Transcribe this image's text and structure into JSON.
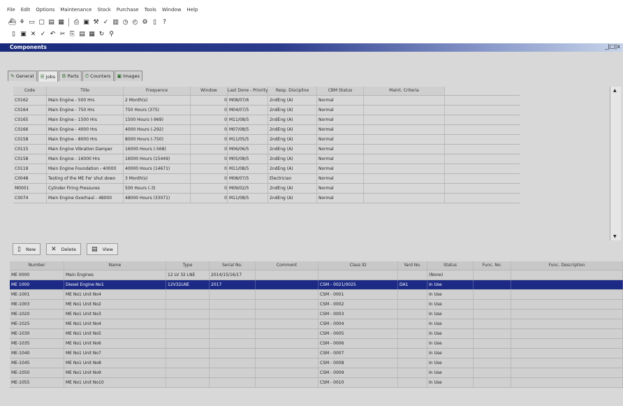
{
  "menu": [
    "File",
    "Edit",
    "Options",
    "Maintenance",
    "Stock",
    "Purchase",
    "Tools",
    "Window",
    "Help"
  ],
  "window": {
    "title": "Components",
    "controls": "_|□|x"
  },
  "tabs": [
    {
      "label": "General",
      "icon": "✎"
    },
    {
      "label": "Jobs",
      "icon": "☰"
    },
    {
      "label": "Parts",
      "icon": "⚙"
    },
    {
      "label": "Counters",
      "icon": "⏱"
    },
    {
      "label": "Images",
      "icon": "▣"
    }
  ],
  "jobs_columns": [
    "Code",
    "Title",
    "Frequence",
    "Window",
    "Last Done - Priority",
    "Resp. Discipline",
    "CBM Status",
    "Maint. Criteria"
  ],
  "jobs_rows": [
    [
      "C0162",
      "Main Engine - 500 Hrs",
      "2 Month(s)",
      "0",
      "M08/07/6",
      "2ndEng (A)",
      "Normal",
      ""
    ],
    [
      "C0164",
      "Main Engine - 750 Hrs",
      "750 Hours (375)",
      "0",
      "M04/07/5",
      "2ndEng (A)",
      "Normal",
      ""
    ],
    [
      "C0165",
      "Main Engine - 1500 Hrs",
      "1500 Hours (-969)",
      "0",
      "M11/08/5",
      "2ndEng (A)",
      "Normal",
      ""
    ],
    [
      "C0166",
      "Main Engine - 4000 Hrs",
      "4000 Hours (-292)",
      "0",
      "M07/08/5",
      "2ndEng (A)",
      "Normal",
      ""
    ],
    [
      "C0158",
      "Main Engine - 8000 Hrs",
      "8000 Hours (-750)",
      "0",
      "M11/05/5",
      "2ndEng (A)",
      "Normal",
      ""
    ],
    [
      "C0115",
      "Main Engine Vibration Damper",
      "16000 Hours (-568)",
      "0",
      "M06/06/5",
      "2ndEng (A)",
      "Normal",
      ""
    ],
    [
      "C0158",
      "Main Engine - 16000 Hrs",
      "16000 Hours (15449)",
      "0",
      "M05/08/5",
      "2ndEng (A)",
      "Normal",
      ""
    ],
    [
      "C0119",
      "Main Engine Foundation - 40000",
      "40000 Hours (14671)",
      "0",
      "M11/08/5",
      "2ndEng (A)",
      "Normal",
      ""
    ],
    [
      "C0048",
      "Testing of the ME Fw' shut down",
      "3 Month(s)",
      "0",
      "M08/07/5",
      "Electrician",
      "Normal",
      ""
    ],
    [
      "M0001",
      "Cylinder Firing Pressures",
      "500 Hours (-3)",
      "0",
      "M09/02/5",
      "2ndEng (A)",
      "Normal",
      ""
    ],
    [
      "C0074",
      "Main Engine Overhaul - 48000",
      "48000 Hours (33071)",
      "0",
      "M11/08/5",
      "2ndEng (A)",
      "Normal",
      ""
    ]
  ],
  "buttons": {
    "new": "New",
    "delete": "Delete",
    "view": "View"
  },
  "comp_columns": [
    "Number",
    "Name",
    "Type",
    "Serial No.",
    "Comment",
    "Class ID",
    "Yard No.",
    "Status",
    "Func. No.",
    "Func. Description"
  ],
  "comp_rows": [
    [
      "ME 0000",
      "Main Engines",
      "12 LV 32 LNE",
      "2014/15/16/17",
      "",
      "",
      "",
      "(None)",
      "",
      ""
    ],
    [
      "ME 1000",
      "Diesel Engine No1",
      "12V32LNE",
      "2017",
      "",
      "CSM - 0021/0025",
      "DA1",
      "In Use",
      "",
      ""
    ],
    [
      "ME-1001",
      "ME No1 Unit No4",
      "",
      "",
      "",
      "CSM - 0001",
      "",
      "In Use",
      "",
      ""
    ],
    [
      "ME-1003",
      "ME No1 Unit No2",
      "",
      "",
      "",
      "CSM - 0002",
      "",
      "In Use",
      "",
      ""
    ],
    [
      "ME-1020",
      "ME No1 Unit No3",
      "",
      "",
      "",
      "CSM - 0003",
      "",
      "In Use",
      "",
      ""
    ],
    [
      "ME-1025",
      "ME No1 Unit No4",
      "",
      "",
      "",
      "CSM - 0004",
      "",
      "In Use",
      "",
      ""
    ],
    [
      "ME-1030",
      "ME No1 Unit No5",
      "",
      "",
      "",
      "CSM - 0005",
      "",
      "In Use",
      "",
      ""
    ],
    [
      "ME-1035",
      "ME No1 Unit No6",
      "",
      "",
      "",
      "CSM - 0006",
      "",
      "In Use",
      "",
      ""
    ],
    [
      "ME-1040",
      "ME No1 Unit No7",
      "",
      "",
      "",
      "CSM - 0007",
      "",
      "In Use",
      "",
      ""
    ],
    [
      "ME-1045",
      "ME No1 Unit No8",
      "",
      "",
      "",
      "CSM - 0008",
      "",
      "In Use",
      "",
      ""
    ],
    [
      "ME-1050",
      "ME No1 Unit No9",
      "",
      "",
      "",
      "CSM - 0009",
      "",
      "In Use",
      "",
      ""
    ],
    [
      "ME-1055",
      "ME No1 Unit No10",
      "",
      "",
      "",
      "CSM - 0010",
      "",
      "In Use",
      "",
      ""
    ]
  ]
}
